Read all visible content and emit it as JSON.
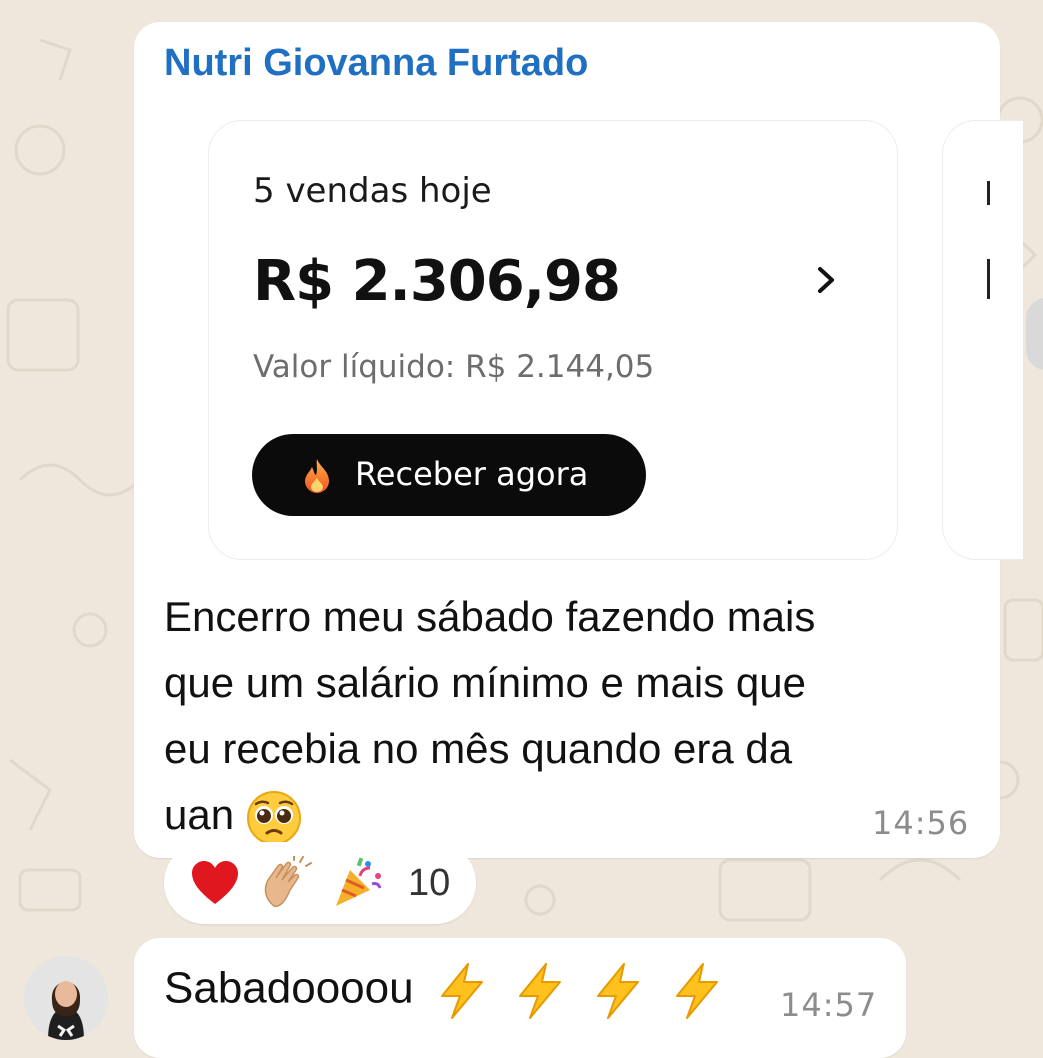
{
  "messages": [
    {
      "sender": "Nutri Giovanna Furtado",
      "card": {
        "sales_count": "5 vendas hoje",
        "amount": "R$ 2.306,98",
        "net_value": "Valor líquido: R$ 2.144,05",
        "button_label": "Receber agora",
        "button_icon": "flame-icon"
      },
      "text_lines": [
        "Encerro meu sábado fazendo mais",
        "que um salário mínimo e mais que",
        "eu recebia no mês quando era da",
        "uan"
      ],
      "text_emoji": "pleading-face",
      "time": "14:56",
      "reactions": {
        "emojis": [
          "heart",
          "clapping-hands",
          "party-popper"
        ],
        "count": "10"
      }
    },
    {
      "text": "Sabadoooou",
      "text_emojis": [
        "lightning",
        "lightning",
        "lightning",
        "lightning"
      ],
      "time": "14:57"
    }
  ],
  "colors": {
    "sender_name": "#1f6fc2",
    "chat_background": "#efe7dc",
    "bubble": "#ffffff",
    "button_background": "#0b0b0b"
  }
}
